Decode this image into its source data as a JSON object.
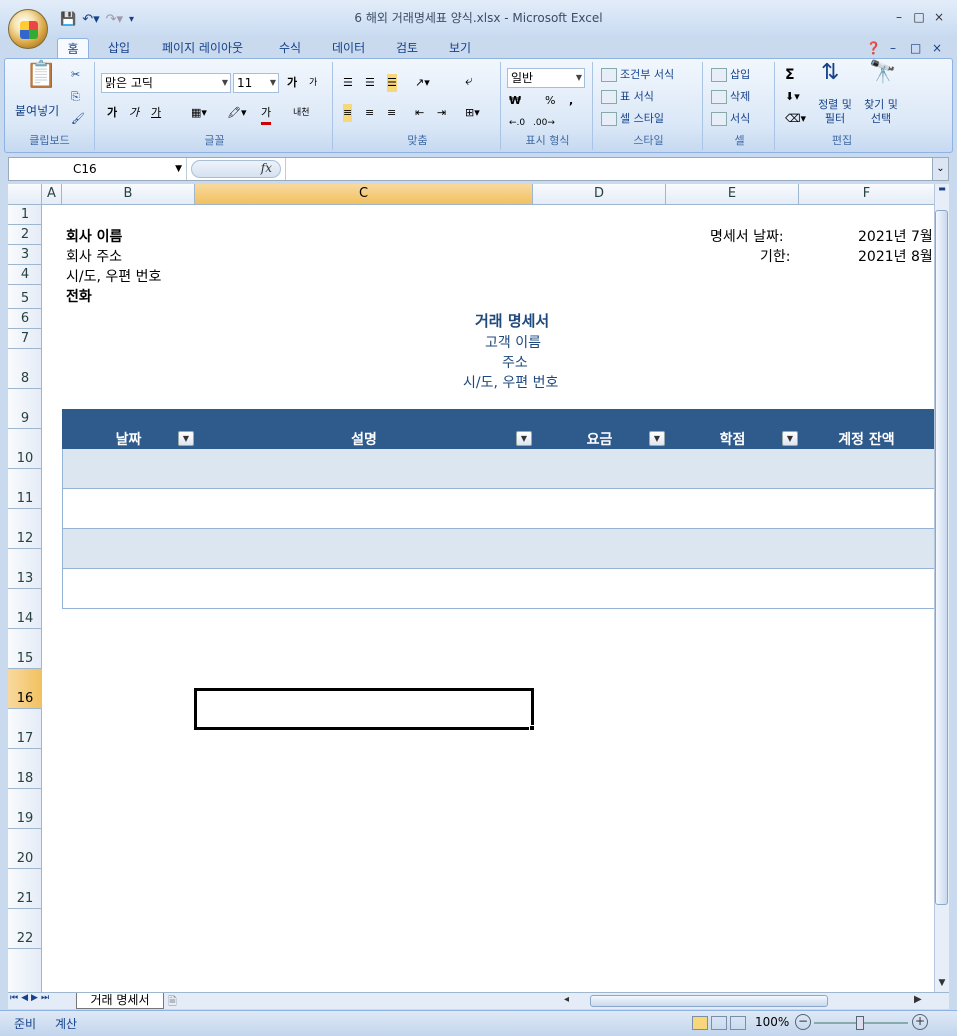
{
  "window": {
    "title": "6 해외 거래명세표 양식.xlsx - Microsoft Excel",
    "min": "–",
    "restore": "□",
    "close": "×"
  },
  "tabs": [
    "홈",
    "삽입",
    "페이지 레이아웃",
    "수식",
    "데이터",
    "검토",
    "보기"
  ],
  "ribbon": {
    "clipboard": {
      "paste": "붙여넣기",
      "label": "클립보드"
    },
    "font": {
      "name": "맑은 고딕",
      "size": "11",
      "label": "글꼴",
      "grow": "가",
      "shrink": "가",
      "bold": "가",
      "italic": "가",
      "underline": "가",
      "color": "가",
      "phonetic": "내천"
    },
    "alignment": {
      "label": "맞춤"
    },
    "number": {
      "format": "일반",
      "currency": "₩",
      "percent": "%",
      "comma": ",",
      "label": "표시 형식"
    },
    "styles": {
      "conditional": "조건부 서식",
      "table": "표 서식",
      "cell": "셀 스타일",
      "label": "스타일"
    },
    "cells": {
      "insert": "삽입",
      "delete": "삭제",
      "format": "서식",
      "label": "셀"
    },
    "editing": {
      "sum": "Σ",
      "sort": "정렬 및\n필터",
      "find": "찾기 및\n선택",
      "label": "편집"
    }
  },
  "formula_bar": {
    "name_box": "C16",
    "fx": "fx",
    "formula": ""
  },
  "columns": [
    "A",
    "B",
    "C",
    "D",
    "E",
    "F"
  ],
  "rows": [
    "1",
    "2",
    "3",
    "4",
    "5",
    "6",
    "7",
    "8",
    "9",
    "10",
    "11",
    "12",
    "13",
    "14",
    "15",
    "16",
    "17",
    "18",
    "19",
    "20",
    "21",
    "22"
  ],
  "sheet": {
    "company_name": "회사 이름",
    "company_address": "회사 주소",
    "company_city": "시/도, 우편 번호",
    "company_phone": "전화",
    "date_label": "명세서 날짜:",
    "date_value": "2021년 7월",
    "due_label": "기한:",
    "due_value": "2021년 8월",
    "title": "거래 명세서",
    "customer_name": "고객 이름",
    "customer_address": "주소",
    "customer_city": "시/도, 우편 번호",
    "table_headers": [
      "날짜",
      "설명",
      "요금",
      "학점",
      "계정 잔액"
    ]
  },
  "sheet_tab": "거래 명세서",
  "status": {
    "ready": "준비",
    "calc": "계산",
    "zoom": "100%"
  }
}
